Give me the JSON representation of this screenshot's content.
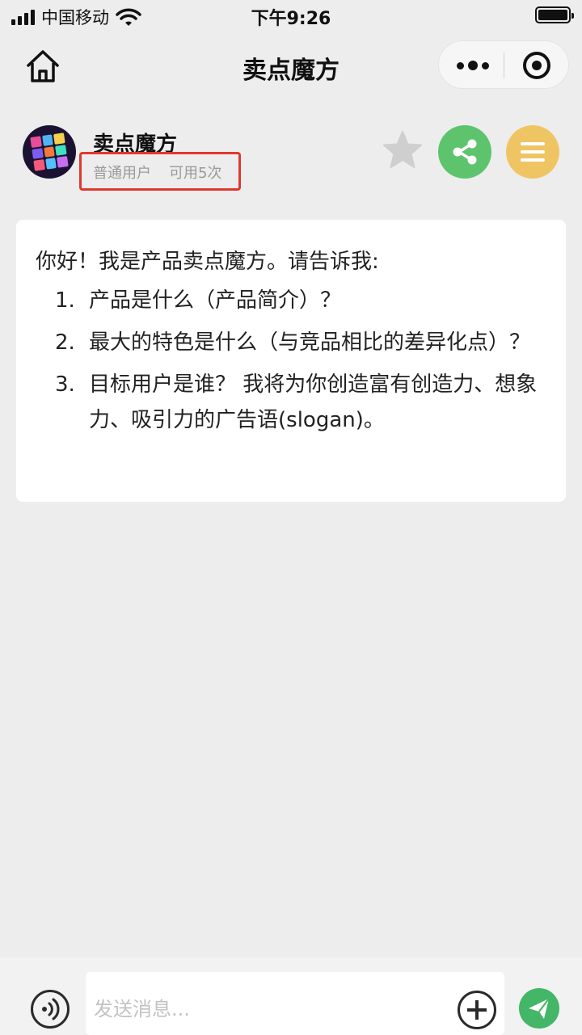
{
  "status_bar": {
    "carrier": "中国移动",
    "time": "下午9:26",
    "icons": [
      "signal-icon",
      "wifi-icon",
      "battery-icon"
    ]
  },
  "nav": {
    "title": "卖点魔方",
    "icons": [
      "home-icon",
      "more-icon",
      "close-icon"
    ]
  },
  "bot": {
    "name": "卖点魔方",
    "user_level": "普通用户",
    "quota": "可用5次",
    "icons": [
      "rubiks-cube-avatar",
      "star-icon",
      "share-icon",
      "menu-icon"
    ]
  },
  "message": {
    "intro": "你好！我是产品卖点魔方。请告诉我:",
    "items": [
      {
        "num": "1.",
        "text": "产品是什么（产品简介）？"
      },
      {
        "num": "2.",
        "text": "最大的特色是什么（与竞品相比的差异化点）？"
      },
      {
        "num": "3.",
        "text": "目标用户是谁？ 我将为你创造富有创造力、想象力、吸引力的广告语(slogan)。"
      }
    ]
  },
  "input": {
    "placeholder": "发送消息...",
    "icons": [
      "voice-icon",
      "plus-icon",
      "send-icon"
    ]
  },
  "colors": {
    "background": "#ededed",
    "highlight_border": "#e0382f",
    "share_green": "#5dc46d",
    "menu_yellow": "#efc563",
    "send_green": "#43b667",
    "star_gray": "#cfcfcf"
  }
}
